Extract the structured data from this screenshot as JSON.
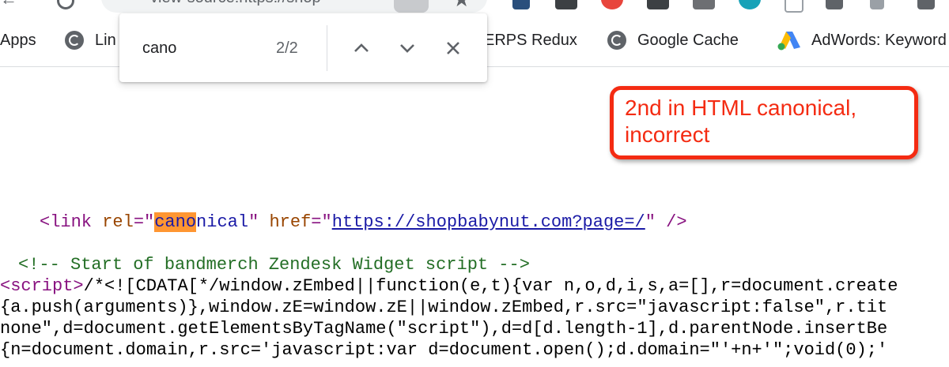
{
  "toolbar": {
    "omnibox_text": "view-source:https://shop",
    "colors": {
      "ext_blue": "#3c4043",
      "ext_red": "#e8453c",
      "ext_teal": "#17a2b8"
    }
  },
  "bookmarks": {
    "items": [
      {
        "label": "Apps",
        "icon": "apps-grid-icon"
      },
      {
        "label": "Lin",
        "icon": "globe-icon"
      },
      {
        "label": "ERPS Redux",
        "icon": "globe-icon"
      },
      {
        "label": "Google Cache",
        "icon": "globe-icon"
      },
      {
        "label": "AdWords: Keyword",
        "icon": "adwords-icon"
      }
    ]
  },
  "find_bar": {
    "query": "cano",
    "count": "2/2",
    "buttons": [
      "previous-match",
      "next-match",
      "close"
    ]
  },
  "annotation": {
    "text": "2nd in HTML canonical, incorrect",
    "color": "#f42b12"
  },
  "source": {
    "link_line": {
      "open": "<link ",
      "rel_attr": "rel",
      "eq1": "=\"",
      "rel_match": "cano",
      "rel_rest": "nical",
      "q1": "\"",
      "href_attr": "href",
      "eq2": "=\"",
      "href": "https://shopbabynut.com?page=/",
      "q2": "\"",
      "close": " />"
    },
    "comment": "<!-- Start of bandmerch Zendesk Widget script -->",
    "script_tag": "<script>",
    "line1_rest": "/*<![CDATA[*/window.zEmbed||function(e,t){var n,o,d,i,s,a=[],r=document.create",
    "line2": "{a.push(arguments)},window.zE=window.zE||window.zEmbed,r.src=\"javascript:false\",r.tit",
    "line3": "none\",d=document.getElementsByTagName(\"script\"),d=d[d.length-1],d.parentNode.insertBe",
    "line4": "{n=document.domain,r.src='javascript:var d=document.open();d.domain=\"'+n+'\";void(0);'"
  }
}
